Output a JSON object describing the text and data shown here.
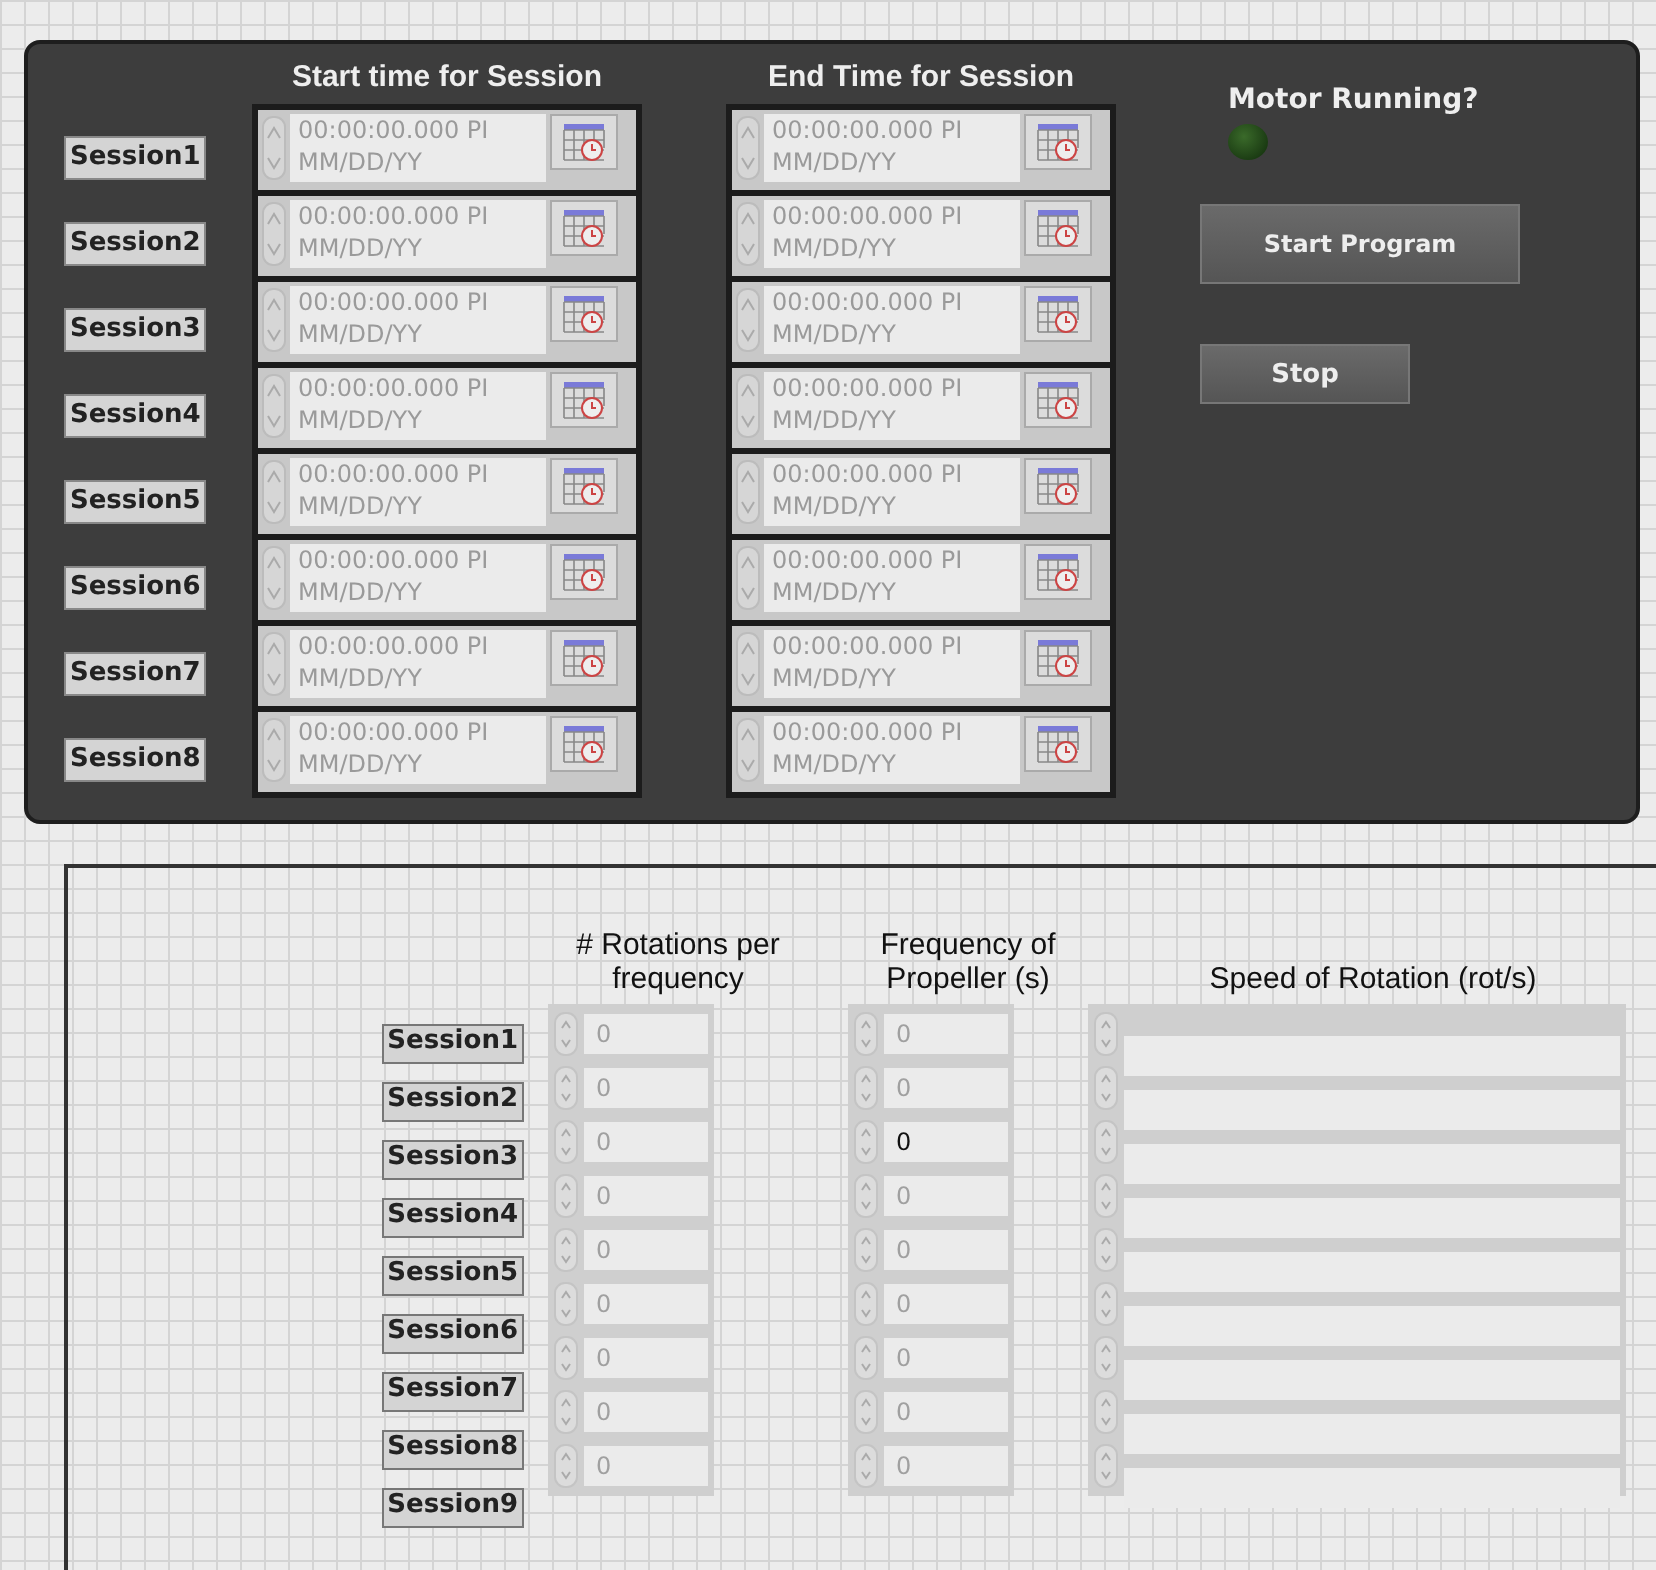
{
  "top_panel": {
    "start_header": "Start time for Session",
    "end_header": "End Time for Session",
    "sessions": [
      {
        "label": "Session1",
        "start": {
          "time": "00:00:00.000 PI",
          "date": "MM/DD/YY"
        },
        "end": {
          "time": "00:00:00.000 PI",
          "date": "MM/DD/YY"
        }
      },
      {
        "label": "Session2",
        "start": {
          "time": "00:00:00.000 PI",
          "date": "MM/DD/YY"
        },
        "end": {
          "time": "00:00:00.000 PI",
          "date": "MM/DD/YY"
        }
      },
      {
        "label": "Session3",
        "start": {
          "time": "00:00:00.000 PI",
          "date": "MM/DD/YY"
        },
        "end": {
          "time": "00:00:00.000 PI",
          "date": "MM/DD/YY"
        }
      },
      {
        "label": "Session4",
        "start": {
          "time": "00:00:00.000 PI",
          "date": "MM/DD/YY"
        },
        "end": {
          "time": "00:00:00.000 PI",
          "date": "MM/DD/YY"
        }
      },
      {
        "label": "Session5",
        "start": {
          "time": "00:00:00.000 PI",
          "date": "MM/DD/YY"
        },
        "end": {
          "time": "00:00:00.000 PI",
          "date": "MM/DD/YY"
        }
      },
      {
        "label": "Session6",
        "start": {
          "time": "00:00:00.000 PI",
          "date": "MM/DD/YY"
        },
        "end": {
          "time": "00:00:00.000 PI",
          "date": "MM/DD/YY"
        }
      },
      {
        "label": "Session7",
        "start": {
          "time": "00:00:00.000 PI",
          "date": "MM/DD/YY"
        },
        "end": {
          "time": "00:00:00.000 PI",
          "date": "MM/DD/YY"
        }
      },
      {
        "label": "Session8",
        "start": {
          "time": "00:00:00.000 PI",
          "date": "MM/DD/YY"
        },
        "end": {
          "time": "00:00:00.000 PI",
          "date": "MM/DD/YY"
        }
      }
    ],
    "motor": {
      "label": "Motor Running?",
      "on": false
    },
    "buttons": [
      "Start Program",
      "Stop"
    ]
  },
  "bottom_panel": {
    "columns": [
      "# Rotations per frequency",
      "Frequency of Propeller (s)",
      "Speed of Rotation (rot/s)"
    ],
    "rows": [
      {
        "label": "Session1",
        "rotations": {
          "value": "0",
          "disabled": true
        },
        "frequency": {
          "value": "0",
          "disabled": true
        }
      },
      {
        "label": "Session2",
        "rotations": {
          "value": "0",
          "disabled": true
        },
        "frequency": {
          "value": "0",
          "disabled": true
        }
      },
      {
        "label": "Session3",
        "rotations": {
          "value": "0",
          "disabled": true
        },
        "frequency": {
          "value": "0",
          "disabled": false
        }
      },
      {
        "label": "Session4",
        "rotations": {
          "value": "0",
          "disabled": true
        },
        "frequency": {
          "value": "0",
          "disabled": true
        }
      },
      {
        "label": "Session5",
        "rotations": {
          "value": "0",
          "disabled": true
        },
        "frequency": {
          "value": "0",
          "disabled": true
        }
      },
      {
        "label": "Session6",
        "rotations": {
          "value": "0",
          "disabled": true
        },
        "frequency": {
          "value": "0",
          "disabled": true
        }
      },
      {
        "label": "Session7",
        "rotations": {
          "value": "0",
          "disabled": true
        },
        "frequency": {
          "value": "0",
          "disabled": true
        }
      },
      {
        "label": "Session8",
        "rotations": {
          "value": "0",
          "disabled": true
        },
        "frequency": {
          "value": "0",
          "disabled": true
        }
      },
      {
        "label": "Session9",
        "rotations": {
          "value": "0",
          "disabled": true
        },
        "frequency": {
          "value": "0",
          "disabled": true
        }
      }
    ]
  }
}
